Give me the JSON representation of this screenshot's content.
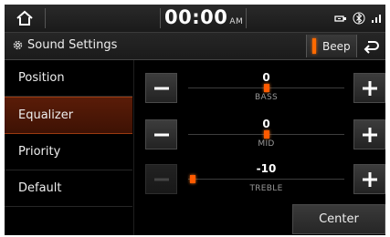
{
  "status_bar": {
    "time": "00:00",
    "ampm": "AM",
    "icons": [
      "home-icon",
      "usb-icon",
      "bluetooth-icon",
      "signal-icon"
    ]
  },
  "title_bar": {
    "title": "Sound Settings",
    "title_icon": "gear-icon",
    "beep_label": "Beep",
    "beep_indicator_color": "#ff6a00",
    "back_icon": "back-arrow-icon"
  },
  "menu": {
    "items": [
      {
        "label": "Position",
        "active": false
      },
      {
        "label": "Equalizer",
        "active": true
      },
      {
        "label": "Priority",
        "active": false
      },
      {
        "label": "Default",
        "active": false
      }
    ]
  },
  "equalizer": {
    "range": [
      -10,
      10
    ],
    "bands": [
      {
        "label": "BASS",
        "value": "0",
        "level": 0,
        "minus_enabled": true,
        "plus_enabled": true
      },
      {
        "label": "MID",
        "value": "0",
        "level": 0,
        "minus_enabled": true,
        "plus_enabled": true
      },
      {
        "label": "TREBLE",
        "value": "-10",
        "level": -10,
        "minus_enabled": false,
        "plus_enabled": true
      }
    ],
    "center_label": "Center"
  },
  "colors": {
    "accent": "#ff5a00",
    "active_menu": "#5a1c08",
    "background": "#000000"
  }
}
